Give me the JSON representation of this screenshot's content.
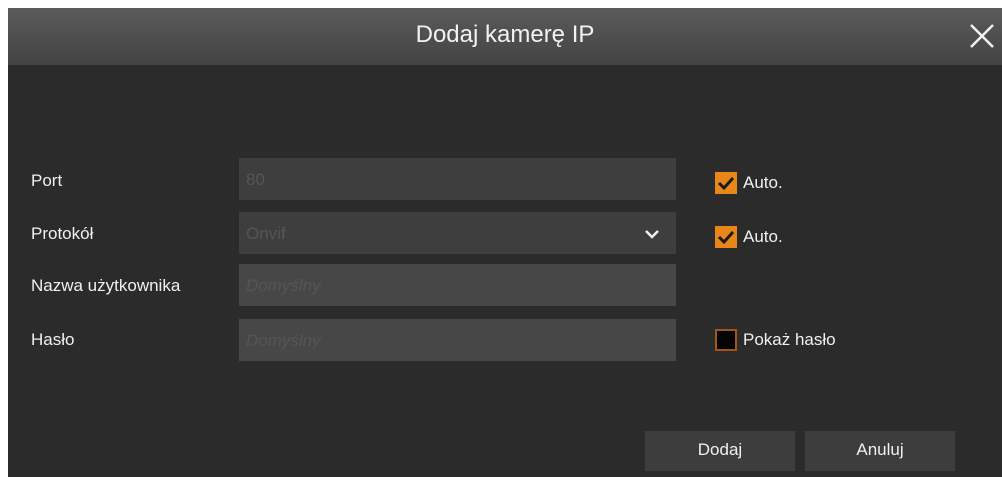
{
  "dialog": {
    "title": "Dodaj kamerę IP",
    "close_icon": "close-icon"
  },
  "form": {
    "port": {
      "label": "Port",
      "value": "80",
      "auto_checked": true,
      "auto_label": "Auto."
    },
    "protocol": {
      "label": "Protokół",
      "value": "Onvif",
      "icon": "chevron-down-icon",
      "auto_checked": true,
      "auto_label": "Auto."
    },
    "username": {
      "label": "Nazwa użytkownika",
      "placeholder": "Domyślny"
    },
    "password": {
      "label": "Hasło",
      "placeholder": "Domyślny",
      "show_checked": false,
      "show_label": "Pokaż hasło"
    }
  },
  "buttons": {
    "add_label": "Dodaj",
    "cancel_label": "Anuluj"
  },
  "colors": {
    "accent": "#e8861a",
    "background": "#2b2b2b",
    "field": "#3e3e3e"
  }
}
